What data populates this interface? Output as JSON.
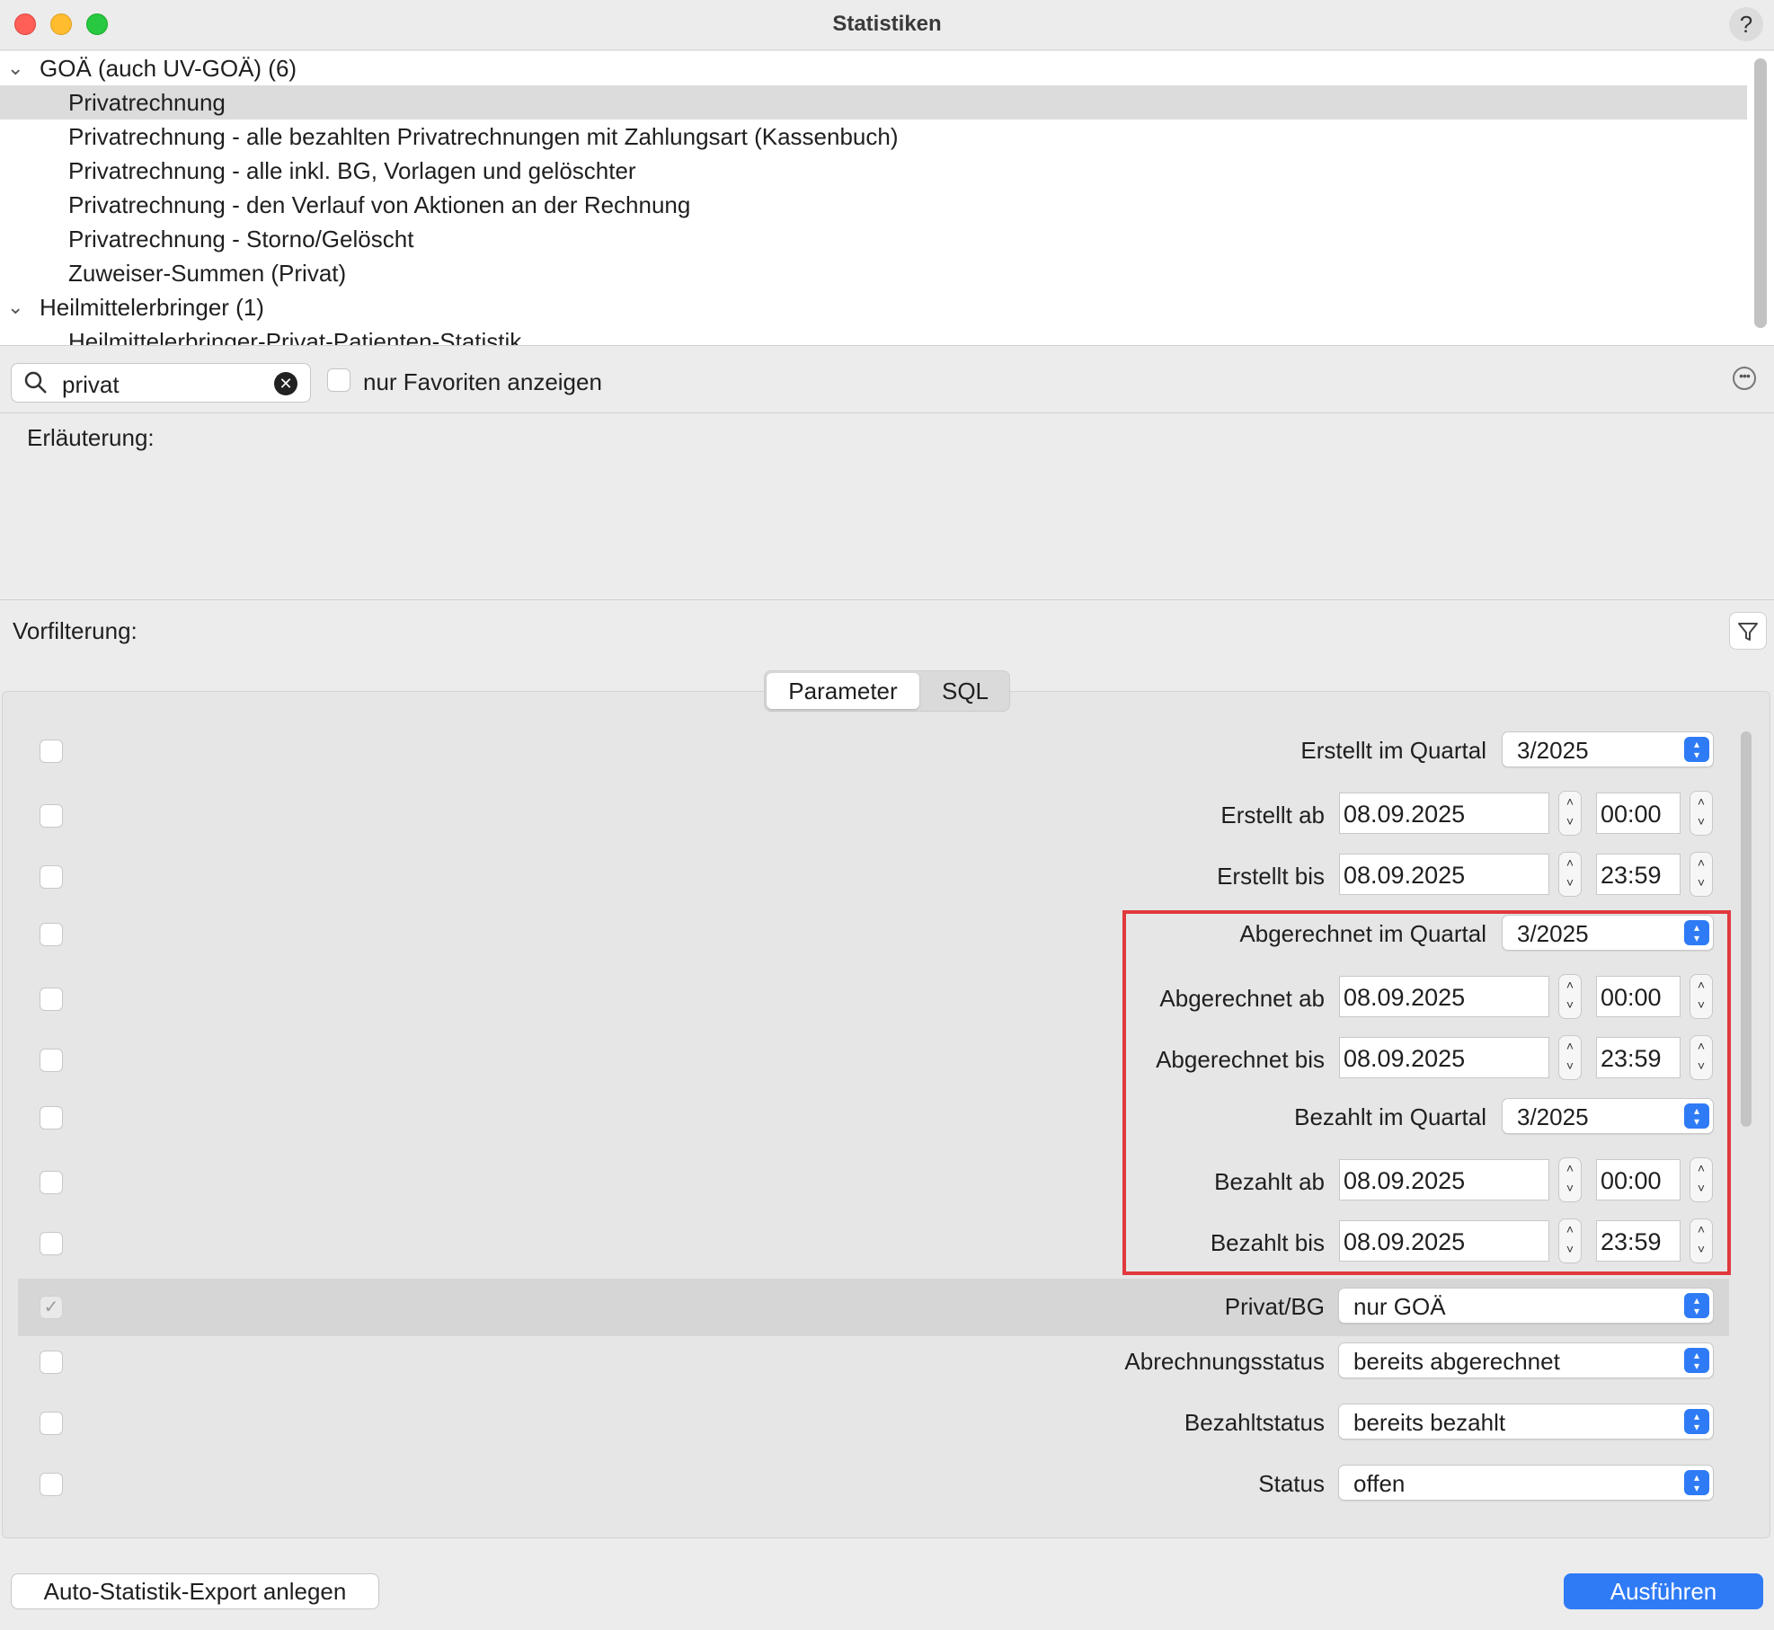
{
  "window": {
    "title": "Statistiken",
    "help": "?"
  },
  "tree": {
    "groups": [
      {
        "label": "GOÄ (auch UV-GOÄ) (6)"
      },
      {
        "label": "Heilmittelerbringer (1)"
      }
    ],
    "items": [
      {
        "label": "Privatrechnung"
      },
      {
        "label": "Privatrechnung - alle bezahlten Privatrechnungen mit Zahlungsart (Kassenbuch)"
      },
      {
        "label": "Privatrechnung - alle inkl. BG, Vorlagen und gelöschter"
      },
      {
        "label": "Privatrechnung - den Verlauf von Aktionen an der Rechnung"
      },
      {
        "label": "Privatrechnung - Storno/Gelöscht"
      },
      {
        "label": "Zuweiser-Summen (Privat)"
      },
      {
        "label": "Heilmittelerbringer-Privat-Patienten-Statistik"
      }
    ]
  },
  "search": {
    "value": "privat",
    "favorites_label": "nur Favoriten anzeigen"
  },
  "explanation_label": "Erläuterung:",
  "prefilter_label": "Vorfilterung:",
  "tabs": {
    "parameter": "Parameter",
    "sql": "SQL"
  },
  "params": [
    {
      "label": "Erstellt im Quartal",
      "value": "3/2025"
    },
    {
      "label": "Erstellt ab",
      "date": "08.09.2025",
      "time": "00:00"
    },
    {
      "label": "Erstellt bis",
      "date": "08.09.2025",
      "time": "23:59"
    },
    {
      "label": "Abgerechnet im Quartal",
      "value": "3/2025"
    },
    {
      "label": "Abgerechnet ab",
      "date": "08.09.2025",
      "time": "00:00"
    },
    {
      "label": "Abgerechnet bis",
      "date": "08.09.2025",
      "time": "23:59"
    },
    {
      "label": "Bezahlt im Quartal",
      "value": "3/2025"
    },
    {
      "label": "Bezahlt ab",
      "date": "08.09.2025",
      "time": "00:00"
    },
    {
      "label": "Bezahlt bis",
      "date": "08.09.2025",
      "time": "23:59"
    },
    {
      "label": "Privat/BG",
      "value": "nur GOÄ",
      "checked": true
    },
    {
      "label": "Abrechnungsstatus",
      "value": "bereits abgerechnet"
    },
    {
      "label": "Bezahltstatus",
      "value": "bereits bezahlt"
    },
    {
      "label": "Status",
      "value": "offen"
    }
  ],
  "buttons": {
    "auto_export": "Auto-Statistik-Export anlegen",
    "run": "Ausführen"
  },
  "colors": {
    "accent": "#2f7bf6",
    "highlight_border": "#e0393e",
    "selection": "#dcdcdc"
  }
}
